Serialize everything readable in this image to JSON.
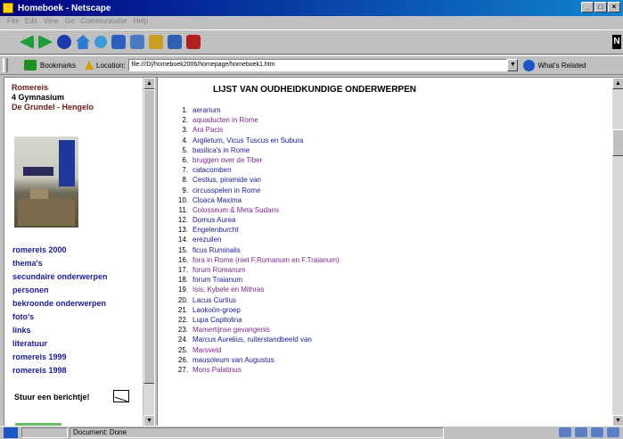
{
  "window": {
    "title": "Homeboek - Netscape"
  },
  "menubar": [
    "File",
    "Edit",
    "View",
    "Go",
    "Communicator",
    "Help"
  ],
  "toolbar": {
    "icons": [
      "back-icon",
      "forward-icon",
      "reload-icon",
      "home-icon",
      "search-icon",
      "guide-icon",
      "print-icon",
      "security-icon",
      "shop-icon",
      "stop-icon"
    ]
  },
  "locbar": {
    "bookmarks_label": "Bookmarks",
    "location_label": "Location:",
    "url": "file:///D|/homeboek2006/homepage/homeboek1.htm",
    "whats_related": "What's Related"
  },
  "left": {
    "header_line1": "Romereis",
    "header_line2": "4 Gymnasium",
    "header_line3": "De Grundel - Hengelo",
    "nav": [
      "romereis 2000",
      "thema's",
      "secundaire onderwerpen",
      "personen",
      "bekroonde onderwerpen",
      "foto's",
      "links",
      "literatuur",
      "romereis 1999",
      "romereis 1998"
    ],
    "message": "Stuur een berichtje!"
  },
  "right": {
    "title": "LIJST VAN OUDHEIDKUNDIGE ONDERWERPEN",
    "items": [
      {
        "num": "1.",
        "text": "aerarium"
      },
      {
        "num": "2.",
        "text": "aquaducten in Rome"
      },
      {
        "num": "3.",
        "text": "Ara Pacis"
      },
      {
        "num": "4.",
        "text": "Argiletum, Vicus Tuscus en Subura"
      },
      {
        "num": "5.",
        "text": "basilica's in Rome"
      },
      {
        "num": "6.",
        "text": "bruggen over de Tiber"
      },
      {
        "num": "7.",
        "text": "catacomben"
      },
      {
        "num": "8.",
        "text": "Cestius, piramide van"
      },
      {
        "num": "9.",
        "text": "circusspelen in Rome"
      },
      {
        "num": "10.",
        "text": "Cloaca Maxima"
      },
      {
        "num": "11.",
        "text": "Colosseum & Meta Sudans"
      },
      {
        "num": "12.",
        "text": "Domus Aurea"
      },
      {
        "num": "13.",
        "text": "Engelenburcht"
      },
      {
        "num": "14.",
        "text": "erezuilen"
      },
      {
        "num": "15.",
        "text": "ficus Ruminalis"
      },
      {
        "num": "16.",
        "text": "fora in Rome (niet F.Romanum en F.Traianum)"
      },
      {
        "num": "17.",
        "text": "forum Romanum"
      },
      {
        "num": "18.",
        "text": "forum Traianum"
      },
      {
        "num": "19.",
        "text": "Isis, Kybele en Mithras"
      },
      {
        "num": "20.",
        "text": "Lacus Curtius"
      },
      {
        "num": "21.",
        "text": "Laokoön-groep"
      },
      {
        "num": "22.",
        "text": "Lupa Capitolina"
      },
      {
        "num": "23.",
        "text": "Mamertijnse gevangenis"
      },
      {
        "num": "24.",
        "text": "Marcus Aurelius, ruiterstandbeeld van"
      },
      {
        "num": "25.",
        "text": "Marsveld"
      },
      {
        "num": "26.",
        "text": "mausoleum van Augustus"
      },
      {
        "num": "27.",
        "text": "Mons Palatinus"
      }
    ]
  },
  "status": {
    "text": "Document: Done"
  }
}
